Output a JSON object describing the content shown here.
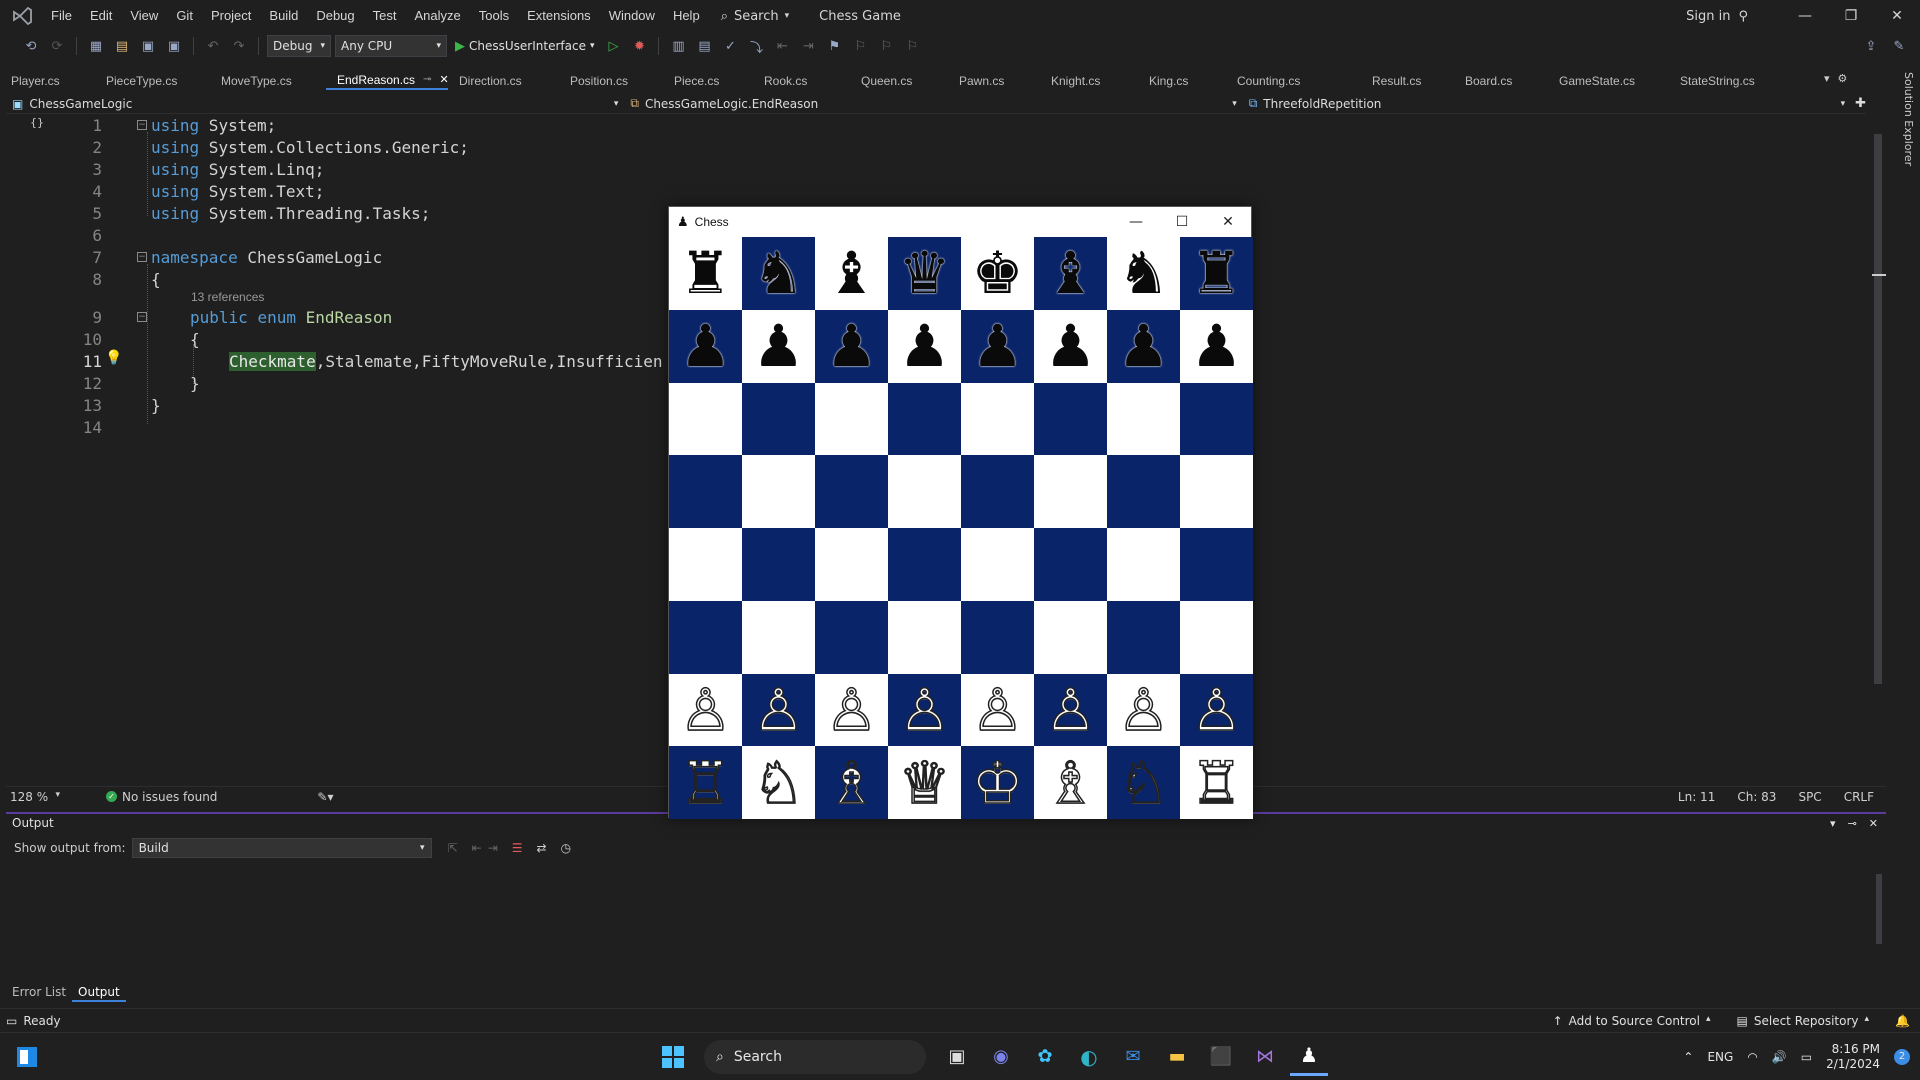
{
  "menu": {
    "items": [
      "File",
      "Edit",
      "View",
      "Git",
      "Project",
      "Build",
      "Debug",
      "Test",
      "Analyze",
      "Tools",
      "Extensions",
      "Window",
      "Help"
    ],
    "search_label": "Search",
    "solution_name": "Chess Game",
    "sign_in": "Sign in"
  },
  "toolbar": {
    "config": "Debug",
    "platform": "Any CPU",
    "startup_project": "ChessUserInterface"
  },
  "tabs": [
    "Player.cs",
    "PieceType.cs",
    "MoveType.cs",
    "EndReason.cs",
    "Direction.cs",
    "Position.cs",
    "Piece.cs",
    "Rook.cs",
    "Queen.cs",
    "Pawn.cs",
    "Knight.cs",
    "King.cs",
    "Counting.cs",
    "Result.cs",
    "Board.cs",
    "GameState.cs",
    "StateString.cs"
  ],
  "active_tab": "EndReason.cs",
  "navbar": {
    "project": "ChessGameLogic",
    "type": "ChessGameLogic.EndReason",
    "member": "ThreefoldRepetition"
  },
  "editor": {
    "line_numbers": [
      "1",
      "2",
      "3",
      "4",
      "5",
      "6",
      "7",
      "8",
      "9",
      "10",
      "11",
      "12",
      "13",
      "14"
    ],
    "current_line": "11",
    "references": "13 references",
    "lines": {
      "l1": [
        "using",
        " System;"
      ],
      "l2": [
        "using",
        " System.Collections.Generic;"
      ],
      "l3": [
        "using",
        " System.Linq;"
      ],
      "l4": [
        "using",
        " System.Text;"
      ],
      "l5": [
        "using",
        " System.Threading.Tasks;"
      ],
      "l7": [
        "namespace",
        " ChessGameLogic"
      ],
      "l8": "{",
      "l9": [
        "public",
        " ",
        "enum",
        " ",
        "EndReason"
      ],
      "l10": "{",
      "l11": [
        "Checkmate",
        ",",
        "Stalemate",
        ",",
        "FiftyMoveRule",
        ",",
        "Insufficien"
      ],
      "l12": "}",
      "l13": "}"
    }
  },
  "editor_status": {
    "zoom": "128 %",
    "issues": "No issues found",
    "line": "Ln: 11",
    "char": "Ch: 83",
    "whitespace": "SPC",
    "line_ending": "CRLF"
  },
  "output": {
    "title": "Output",
    "show_from_label": "Show output from:",
    "source": "Build"
  },
  "bottom_tabs": [
    "Error List",
    "Output"
  ],
  "statusbar": {
    "ready": "Ready",
    "add_source": "Add to Source Control",
    "select_repo": "Select Repository"
  },
  "side_panel": "Solution Explorer",
  "chess_window": {
    "title": "Chess",
    "board": [
      [
        "♜",
        "♞",
        "♝",
        "♛",
        "♚",
        "♝",
        "♞",
        "♜"
      ],
      [
        "♟",
        "♟",
        "♟",
        "♟",
        "♟",
        "♟",
        "♟",
        "♟"
      ],
      [
        "",
        "",
        "",
        "",
        "",
        "",
        "",
        ""
      ],
      [
        "",
        "",
        "",
        "",
        "",
        "",
        "",
        ""
      ],
      [
        "",
        "",
        "",
        "",
        "",
        "",
        "",
        ""
      ],
      [
        "",
        "",
        "",
        "",
        "",
        "",
        "",
        ""
      ],
      [
        "♙",
        "♙",
        "♙",
        "♙",
        "♙",
        "♙",
        "♙",
        "♙"
      ],
      [
        "♖",
        "♘",
        "♗",
        "♕",
        "♔",
        "♗",
        "♘",
        "♖"
      ]
    ],
    "light_color": "#ffffff",
    "dark_color": "#0a2469"
  },
  "taskbar": {
    "search_label": "Search",
    "language": "ENG",
    "time": "8:16 PM",
    "date": "2/1/2024",
    "notification_count": "2"
  }
}
